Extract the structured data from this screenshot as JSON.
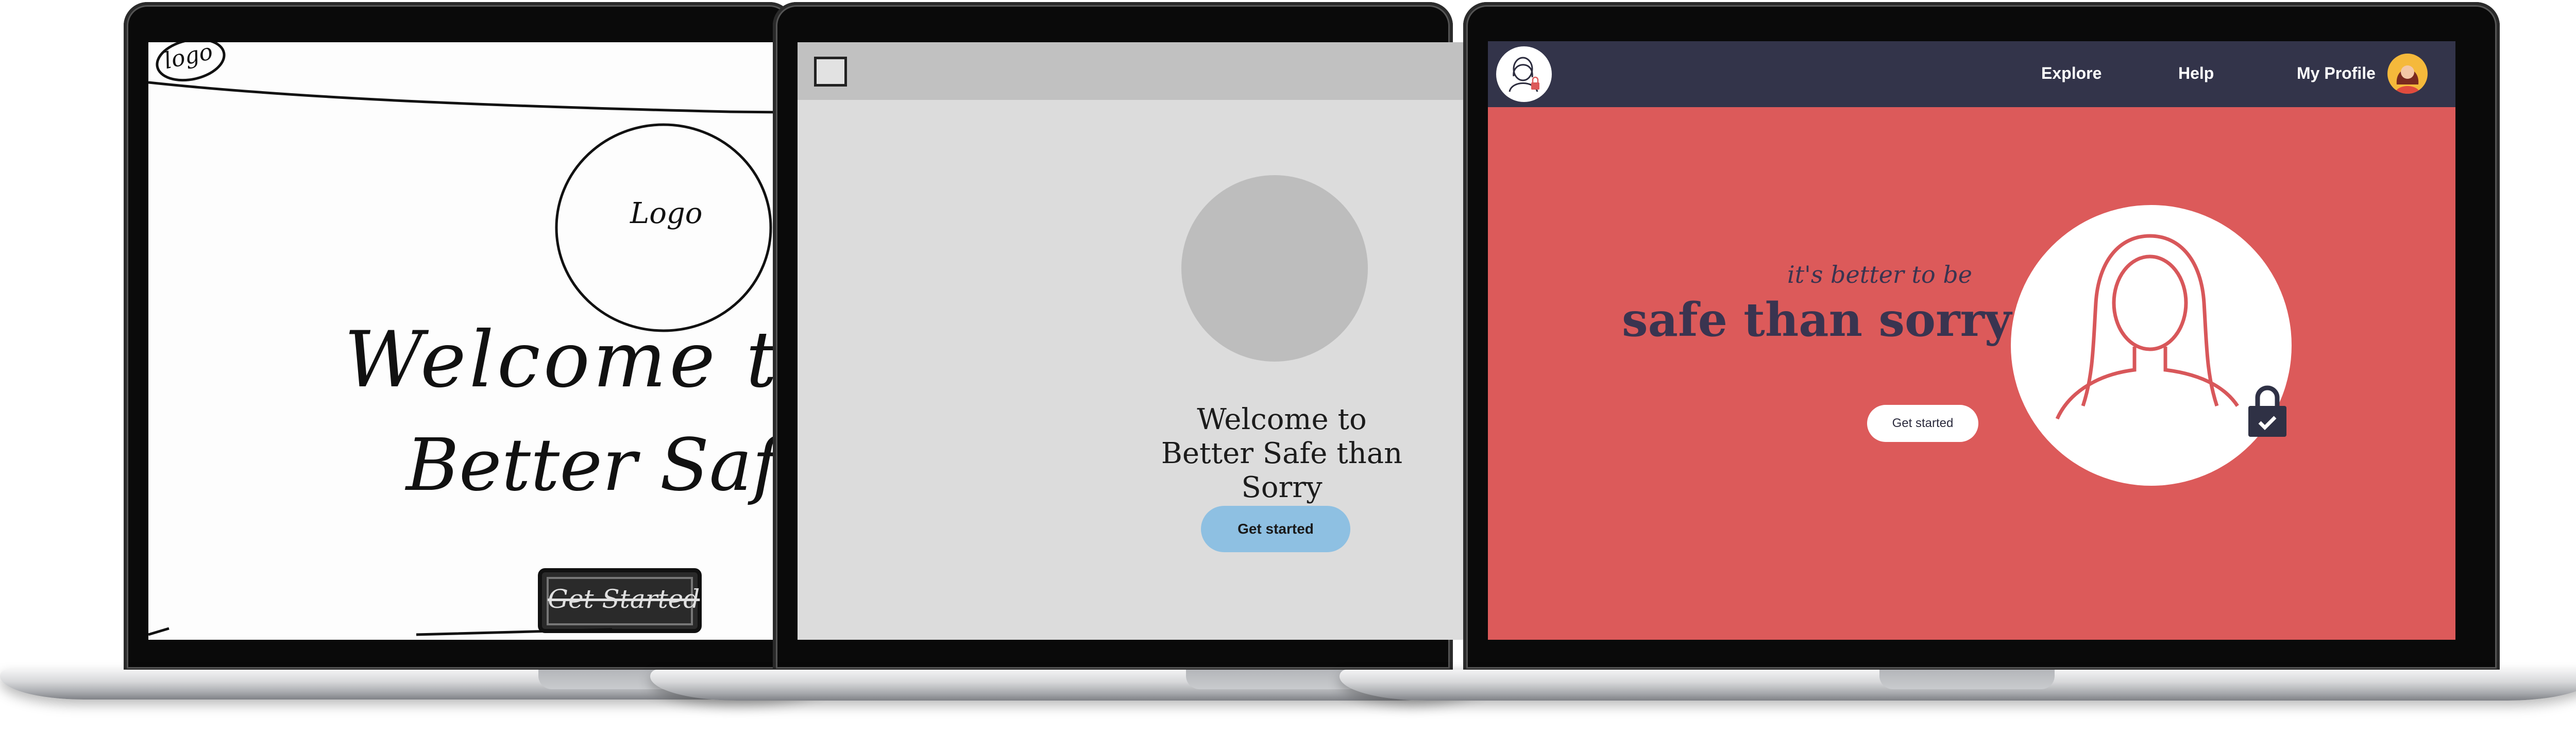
{
  "sketch": {
    "corner_logo": "logo",
    "circle_logo": "Logo",
    "line1": "Welcome to",
    "line2": "Better Safe than",
    "button_label": "Get Started"
  },
  "wireframe": {
    "welcome_line1": "Welcome to",
    "welcome_line2": "Better Safe than Sorry",
    "button_label": "Get started",
    "button_color": "#8ec0e2",
    "placeholder_color": "#bdbdbd",
    "background_color": "#dcdcdc"
  },
  "final": {
    "nav": {
      "items": [
        "Explore",
        "Help",
        "My Profile"
      ]
    },
    "tagline_small": "it's better to be",
    "tagline_large": "safe than sorry",
    "button_label": "Get started",
    "colors": {
      "navbar": "#33344a",
      "background": "#dc5a5a",
      "text": "#3a3450",
      "accent": "#dc5a5a"
    },
    "icons": [
      "profile-lock-logo-icon",
      "user-avatar-icon",
      "woman-silhouette-icon",
      "padlock-check-icon"
    ]
  }
}
